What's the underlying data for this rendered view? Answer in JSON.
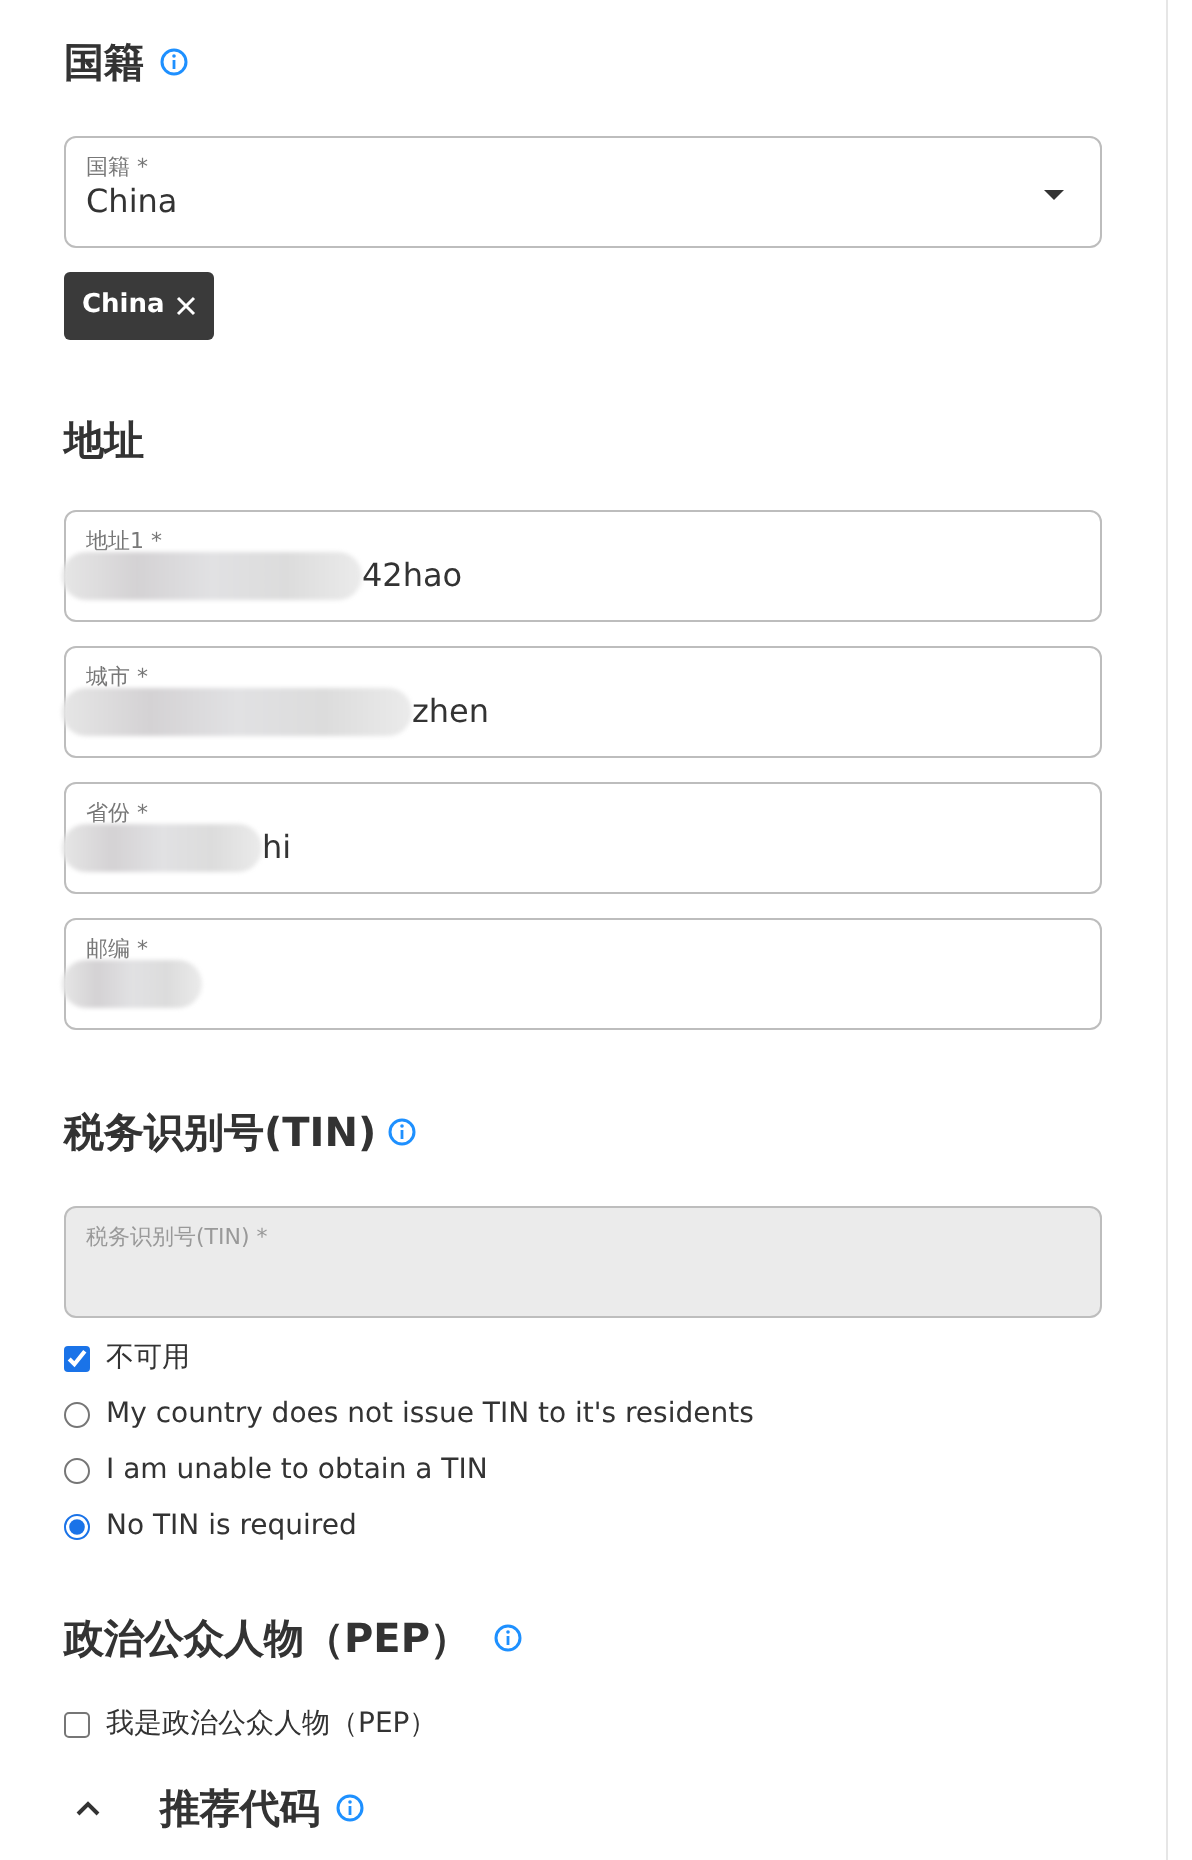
{
  "nationality": {
    "title": "国籍",
    "field": {
      "label": "国籍 *",
      "value": "China"
    },
    "chips": [
      {
        "label": "China"
      }
    ]
  },
  "address": {
    "title": "地址",
    "fields": [
      {
        "label": "地址1 *",
        "value": "42hao",
        "redacted": true
      },
      {
        "label": "城市 *",
        "value": "zhen",
        "redacted": true
      },
      {
        "label": "省份 *",
        "value": "hi",
        "redacted": true
      },
      {
        "label": "邮编 *",
        "redacted": true
      }
    ]
  },
  "tin": {
    "title": "税务识别号(TIN)",
    "field": {
      "label": "税务识别号(TIN) *",
      "disabled": true
    },
    "unavailable": {
      "label": "不可用",
      "checked": true
    },
    "reasons": [
      {
        "label": "My country does not issue TIN to it's residents",
        "selected": false
      },
      {
        "label": "I am unable to obtain a TIN",
        "selected": false
      },
      {
        "label": "No TIN is required",
        "selected": true
      }
    ]
  },
  "pep": {
    "title": "政治公众人物（PEP）",
    "checkbox": {
      "label": "我是政治公众人物（PEP）",
      "checked": false
    }
  },
  "referral": {
    "title": "推荐代码",
    "expanded": true
  }
}
